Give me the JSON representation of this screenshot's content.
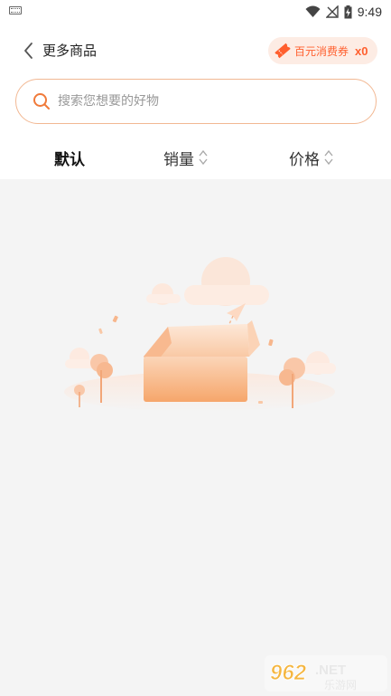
{
  "status_bar": {
    "time": "9:49",
    "icons": [
      "keyboard-icon",
      "wifi-icon",
      "no-signal-icon",
      "battery-charging-icon"
    ]
  },
  "header": {
    "title": "更多商品",
    "back_icon": "chevron-left-icon"
  },
  "coupon": {
    "label": "百元消费券",
    "count": "x0",
    "icon": "ticket-icon",
    "color": "#ff5f2e"
  },
  "search": {
    "placeholder": "搜索您想要的好物",
    "value": "",
    "icon": "search-icon",
    "border_color": "#f2b893"
  },
  "sort_tabs": [
    {
      "label": "默认",
      "active": true
    },
    {
      "label": "销量",
      "active": false,
      "icon": "sort-arrows-icon"
    },
    {
      "label": "价格",
      "active": false,
      "icon": "sort-arrows-icon"
    }
  ],
  "empty_state": {
    "illustration": "empty-box-illustration",
    "accent_color": "#f8a56e"
  },
  "watermark": {
    "text": "962.NET",
    "subtext": "乐游网"
  }
}
